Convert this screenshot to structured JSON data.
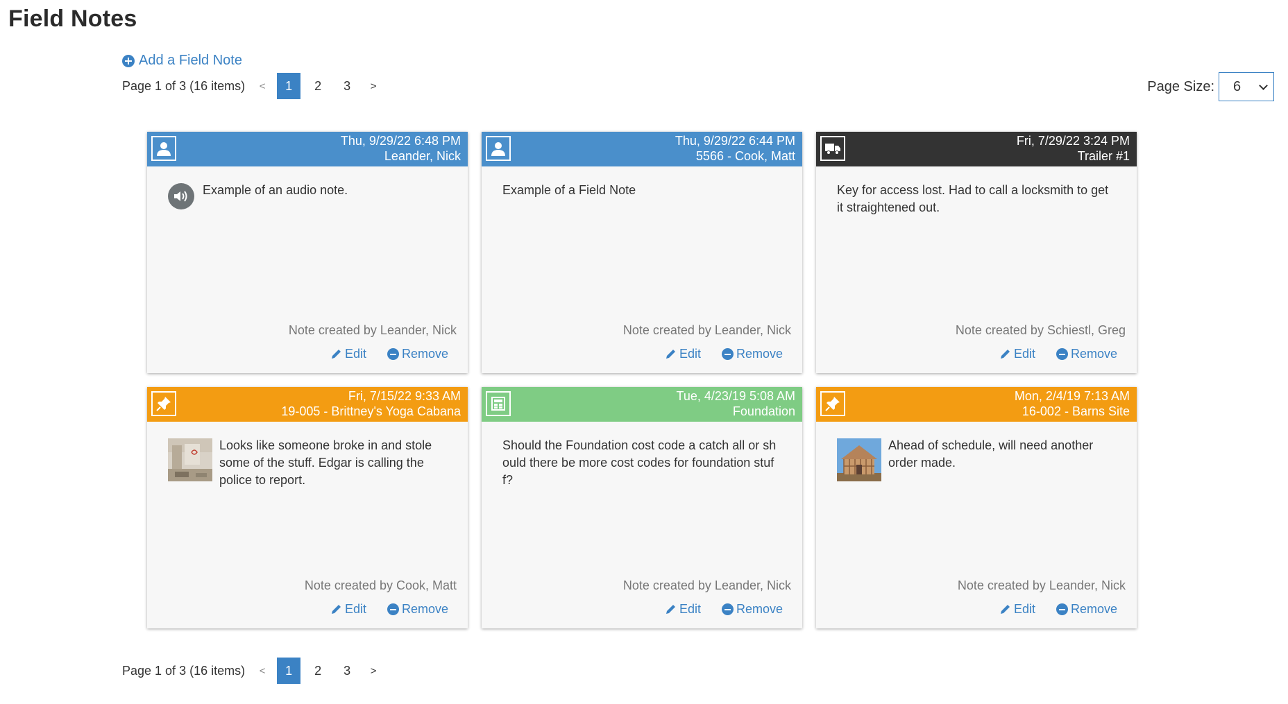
{
  "page": {
    "title": "Field Notes"
  },
  "actions": {
    "add_label": "Add a Field Note"
  },
  "pager": {
    "info": "Page 1 of 3 (16 items)",
    "prev": "<",
    "next": ">",
    "pages": [
      "1",
      "2",
      "3"
    ],
    "current": "1"
  },
  "page_size": {
    "label": "Page Size:",
    "value": "6"
  },
  "colors": {
    "blue": "#4a8fcb",
    "dark": "#333333",
    "orange": "#f39c12",
    "green": "#7fcc84",
    "link": "#3b82c4"
  },
  "notes": [
    {
      "header_color": "#4a8fcb",
      "icon": "user-icon",
      "date": "Thu, 9/29/22 6:48 PM",
      "subtitle": "Leander, Nick",
      "media": "audio-icon",
      "text": "Example of an audio note.",
      "created": "Note created by Leander, Nick",
      "edit": "Edit",
      "remove": "Remove"
    },
    {
      "header_color": "#4a8fcb",
      "icon": "user-icon",
      "date": "Thu, 9/29/22 6:44 PM",
      "subtitle": "5566 - Cook, Matt",
      "media": "",
      "text": "Example of a Field Note",
      "created": "Note created by Leander, Nick",
      "edit": "Edit",
      "remove": "Remove"
    },
    {
      "header_color": "#333333",
      "icon": "truck-icon",
      "date": "Fri, 7/29/22 3:24 PM",
      "subtitle": "Trailer #1",
      "media": "",
      "text": "Key for access lost.  Had to call a locksmith to get it straightened out.",
      "created": "Note created by Schiestl, Greg",
      "edit": "Edit",
      "remove": "Remove"
    },
    {
      "header_color": "#f39c12",
      "icon": "pushpin-icon",
      "date": "Fri, 7/15/22 9:33 AM",
      "subtitle": "19-005 - Brittney's Yoga Cabana",
      "media": "vandalized-room-thumbnail",
      "text": "Looks like someone broke in and stole some of the stuff. Edgar is calling the police to report.",
      "created": "Note created by Cook, Matt",
      "edit": "Edit",
      "remove": "Remove"
    },
    {
      "header_color": "#7fcc84",
      "icon": "cost-code-icon",
      "date": "Tue, 4/23/19 5:08 AM",
      "subtitle": "Foundation",
      "media": "",
      "text": "Should the Foundation cost code a catch all or should there be more cost codes for foundation stuff?",
      "created": "Note created by Leander, Nick",
      "edit": "Edit",
      "remove": "Remove"
    },
    {
      "header_color": "#f39c12",
      "icon": "pushpin-icon",
      "date": "Mon, 2/4/19 7:13 AM",
      "subtitle": "16-002 - Barns Site",
      "media": "house-frame-thumbnail",
      "text": "Ahead of schedule, will need another order made.",
      "created": "Note created by Leander, Nick",
      "edit": "Edit",
      "remove": "Remove"
    }
  ]
}
